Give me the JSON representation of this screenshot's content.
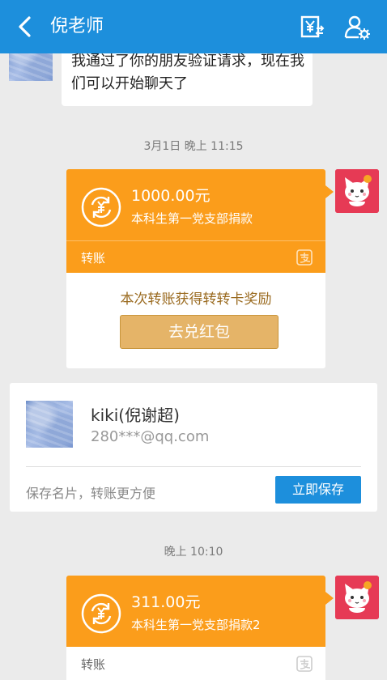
{
  "header": {
    "title": "倪老师",
    "back_icon": "chevron-left-icon",
    "transfer_icon": "yuan-transfer-icon",
    "profile_icon": "user-settings-icon",
    "bg_color": "#1d8fdc"
  },
  "messages": {
    "friend_text": "我通过了你的朋友验证请求，现在我们可以开始聊天了",
    "time1": "3月1日 晚上 11:15",
    "time2": "晚上 10:10"
  },
  "transfer1": {
    "amount": "1000.00元",
    "desc": "本科生第一党支部捐款",
    "label": "转账",
    "bonus": "本次转账获得转转卡奖励",
    "redeem": "去兑红包"
  },
  "card": {
    "name": "kiki(倪谢超)",
    "email": "280***@qq.com",
    "hint": "保存名片，转账更方便",
    "save": "立即保存"
  },
  "transfer2": {
    "amount": "311.00元",
    "desc": "本科生第一党支部捐款2",
    "label": "转账"
  },
  "colors": {
    "accent": "#1d8fdc",
    "transfer": "#fb9d1b",
    "redeem": "#e5b468"
  }
}
